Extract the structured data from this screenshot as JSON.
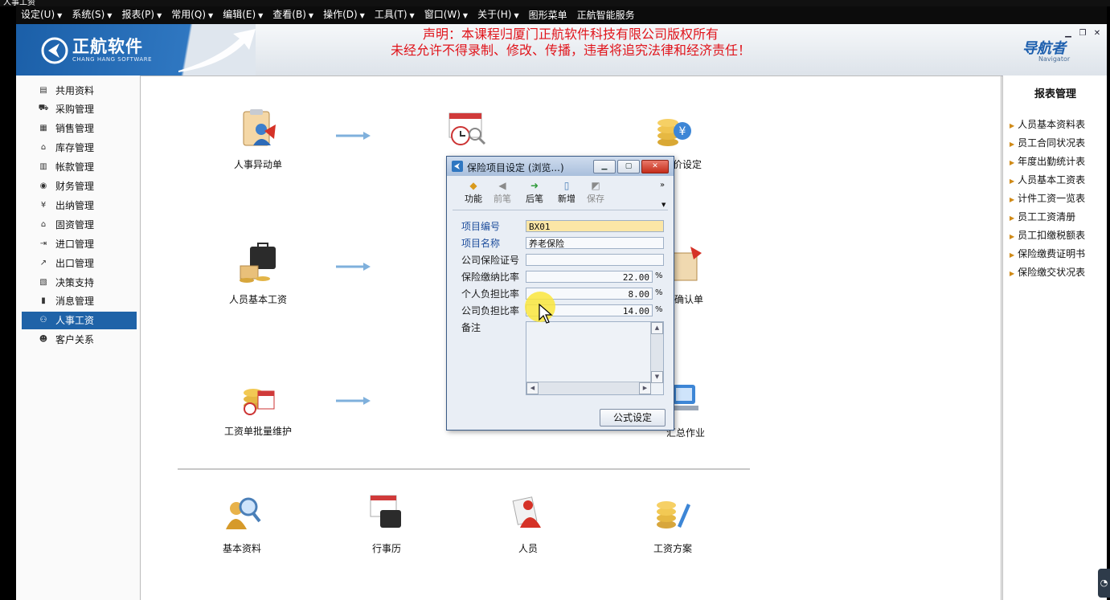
{
  "window": {
    "title": "人事工资"
  },
  "menubar": {
    "items": [
      {
        "label": "设定(U)",
        "caret": true
      },
      {
        "label": "系统(S)",
        "caret": true
      },
      {
        "label": "报表(P)",
        "caret": true
      },
      {
        "label": "常用(Q)",
        "caret": true
      },
      {
        "label": "编辑(E)",
        "caret": true
      },
      {
        "label": "查看(B)",
        "caret": true
      },
      {
        "label": "操作(D)",
        "caret": true
      },
      {
        "label": "工具(T)",
        "caret": true
      },
      {
        "label": "窗口(W)",
        "caret": true
      },
      {
        "label": "关于(H)",
        "caret": true
      },
      {
        "label": "图形菜单",
        "caret": false
      },
      {
        "label": "正航智能服务",
        "caret": false
      }
    ]
  },
  "banner": {
    "logo_name": "正航软件",
    "logo_sub": "CHANG HANG SOFTWARE",
    "notice_line1": "声明：本课程归厦门正航软件科技有限公司版权所有",
    "notice_line2": "未经允许不得录制、修改、传播，违者将追究法律和经济责任！",
    "navigator_title": "导航者",
    "navigator_sub": "Navigator",
    "notice_color": "#e0141b",
    "brand_color": "#1f63a8"
  },
  "sidebar": {
    "items": [
      {
        "label": "共用资料",
        "icon": "list-icon",
        "glyph": "▤"
      },
      {
        "label": "采购管理",
        "icon": "cart-icon",
        "glyph": "⛟"
      },
      {
        "label": "销售管理",
        "icon": "sales-icon",
        "glyph": "▦"
      },
      {
        "label": "库存管理",
        "icon": "warehouse-icon",
        "glyph": "⌂"
      },
      {
        "label": "帐款管理",
        "icon": "ledger-icon",
        "glyph": "▥"
      },
      {
        "label": "财务管理",
        "icon": "finance-icon",
        "glyph": "◉"
      },
      {
        "label": "出纳管理",
        "icon": "cashier-icon",
        "glyph": "¥"
      },
      {
        "label": "固资管理",
        "icon": "asset-icon",
        "glyph": "⌂"
      },
      {
        "label": "进口管理",
        "icon": "import-icon",
        "glyph": "⇥"
      },
      {
        "label": "出口管理",
        "icon": "export-icon",
        "glyph": "↗"
      },
      {
        "label": "决策支持",
        "icon": "decision-icon",
        "glyph": "▧"
      },
      {
        "label": "消息管理",
        "icon": "message-icon",
        "glyph": "▮"
      },
      {
        "label": "人事工资",
        "icon": "hr-icon",
        "glyph": "⚇"
      },
      {
        "label": "客户关系",
        "icon": "customer-icon",
        "glyph": "☻"
      }
    ],
    "active_index": 12
  },
  "main": {
    "tiles": {
      "hr_change": "人事异动单",
      "attendance": "出勤记录",
      "piece_price": "计件单价设定",
      "basic_salary": "人员基本工资",
      "confirm": "确认单",
      "batch_maintain": "工资单批量维护",
      "job": "汇总作业",
      "basic_data": "基本资料",
      "calendar": "行事历",
      "personnel": "人员",
      "salary_plan": "工资方案"
    }
  },
  "right_panel": {
    "title": "报表管理",
    "items": [
      "人员基本资料表",
      "员工合同状况表",
      "年度出勤统计表",
      "人员基本工资表",
      "计件工资一览表",
      "员工工资清册",
      "员工扣缴税额表",
      "保险缴费证明书",
      "保险缴交状况表"
    ]
  },
  "dialog": {
    "title": "保险项目设定 (浏览...)",
    "toolbar": [
      {
        "label": "功能",
        "icon": "function-icon",
        "glyph": "◆",
        "enabled": true
      },
      {
        "label": "前笔",
        "icon": "prev-icon",
        "glyph": "◀",
        "enabled": false
      },
      {
        "label": "后笔",
        "icon": "next-icon",
        "glyph": "➜",
        "enabled": true
      },
      {
        "label": "新增",
        "icon": "new-icon",
        "glyph": "▯",
        "enabled": true
      },
      {
        "label": "保存",
        "icon": "save-icon",
        "glyph": "◩",
        "enabled": false
      }
    ],
    "toolbar_more": "»",
    "fields": {
      "code_label": "项目编号",
      "code_value": "BX01",
      "name_label": "项目名称",
      "name_value": "养老保险",
      "cert_label": "公司保险证号",
      "cert_value": "",
      "rate_label": "保险缴纳比率",
      "rate_value": "22.00",
      "personal_label": "个人负担比率",
      "personal_value": "8.00",
      "company_label": "公司负担比率",
      "company_value": "14.00",
      "unit": "%",
      "memo_label": "备注",
      "memo_value": ""
    },
    "formula_button": "公式设定"
  }
}
